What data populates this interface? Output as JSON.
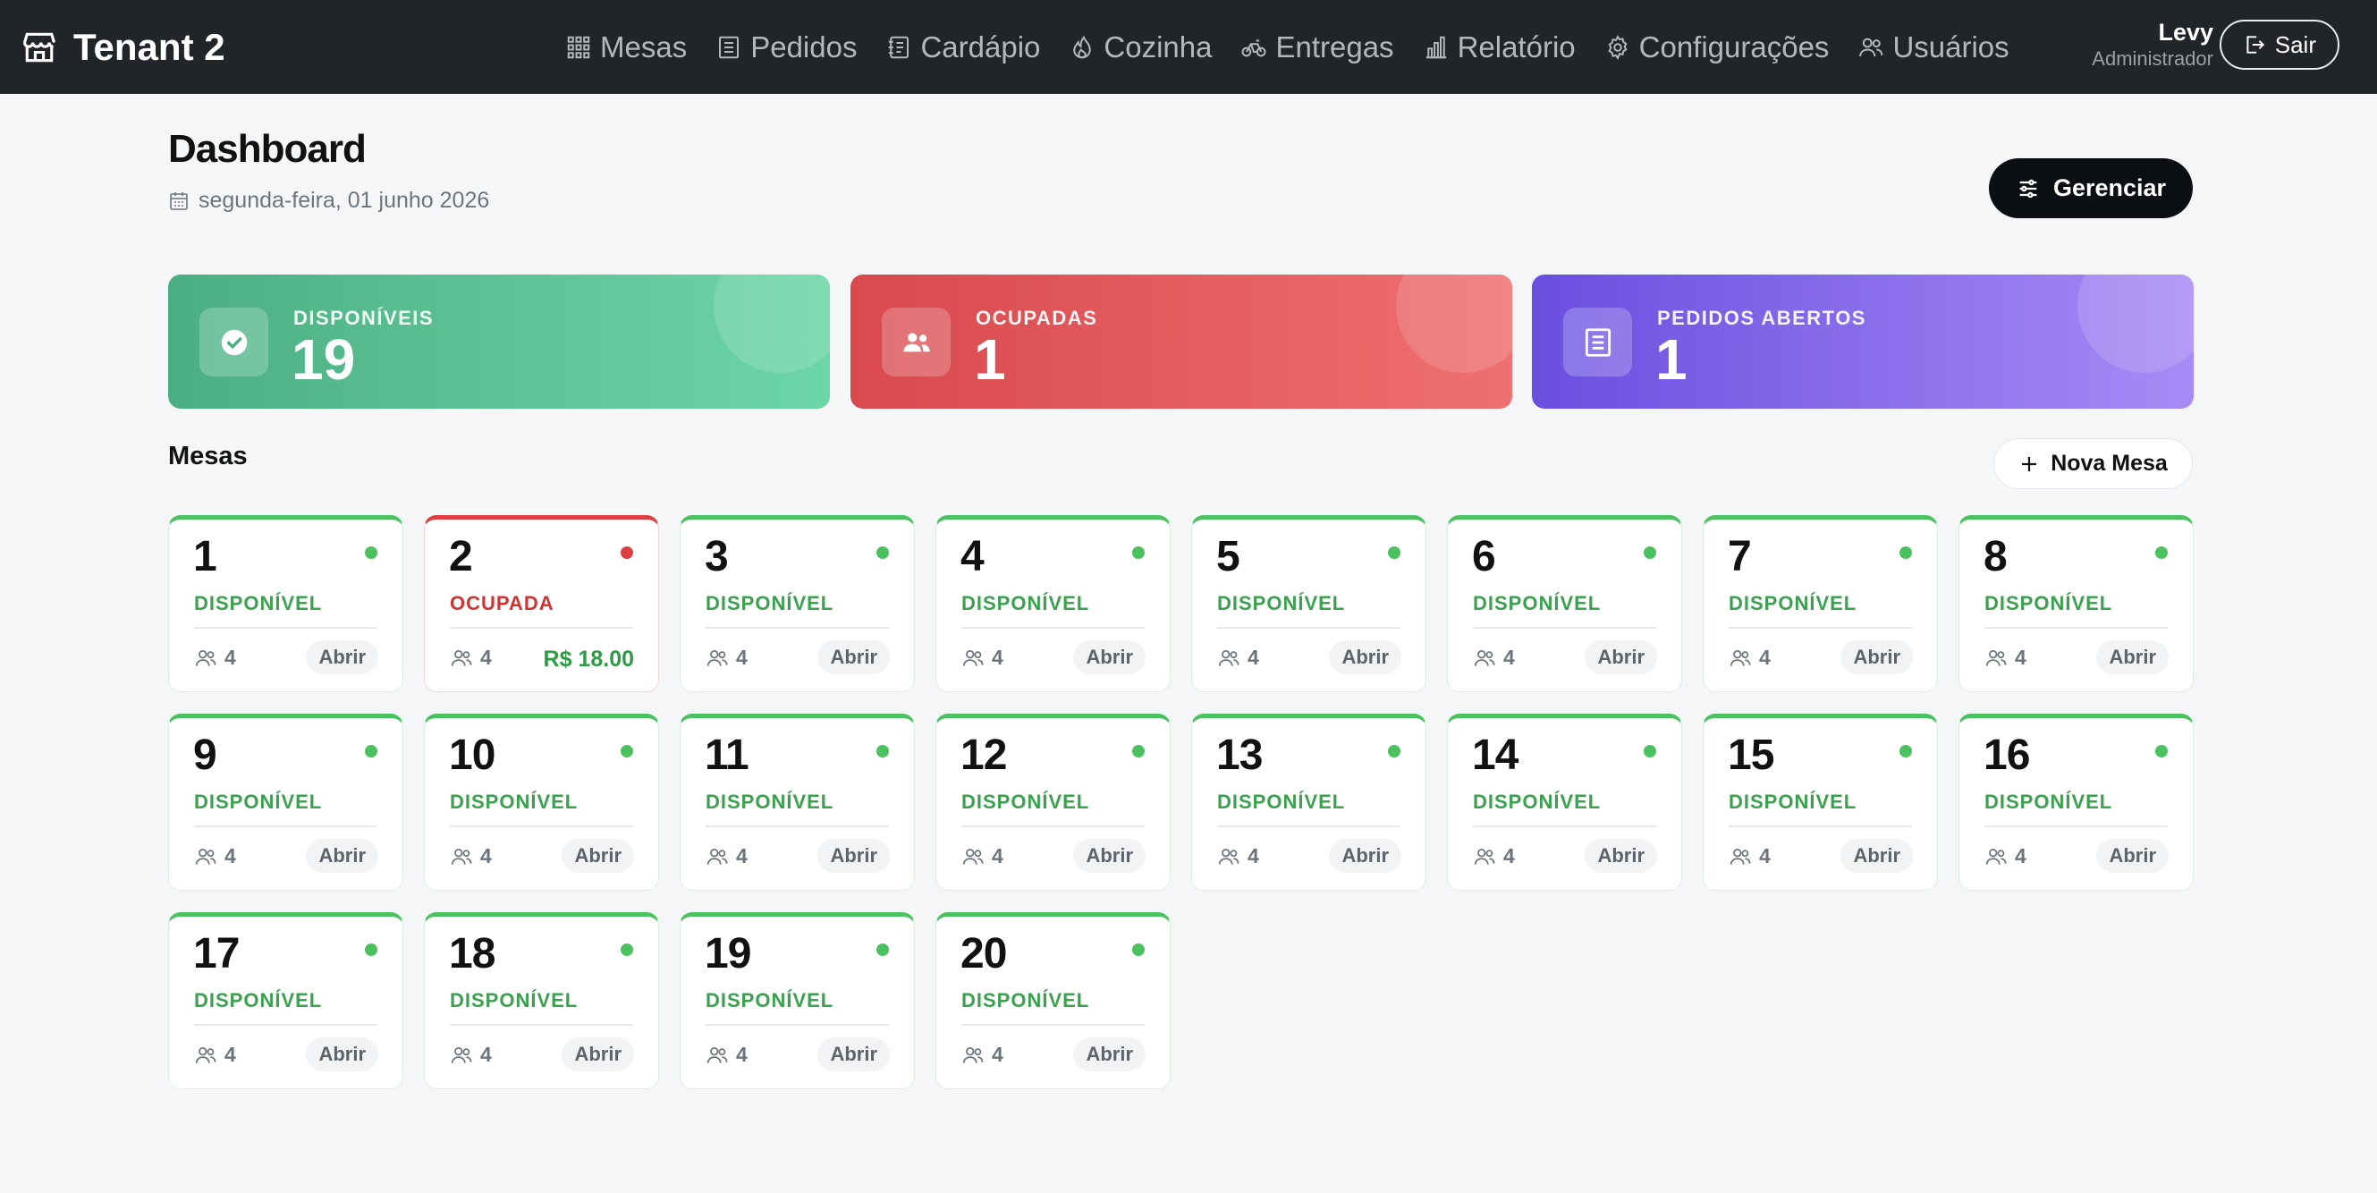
{
  "brand": {
    "name": "Tenant 2",
    "icon": "store-icon"
  },
  "nav": [
    {
      "label": "Mesas",
      "icon": "grid-icon",
      "name": "nav-item-mesas"
    },
    {
      "label": "Pedidos",
      "icon": "receipt-icon",
      "name": "nav-item-pedidos"
    },
    {
      "label": "Cardápio",
      "icon": "menu-book-icon",
      "name": "nav-item-cardapio"
    },
    {
      "label": "Cozinha",
      "icon": "fire-icon",
      "name": "nav-item-cozinha"
    },
    {
      "label": "Entregas",
      "icon": "bicycle-icon",
      "name": "nav-item-entregas"
    },
    {
      "label": "Relatório",
      "icon": "bar-chart-icon",
      "name": "nav-item-relatorio"
    },
    {
      "label": "Configurações",
      "icon": "gear-icon",
      "name": "nav-item-configuracoes"
    },
    {
      "label": "Usuários",
      "icon": "users-icon",
      "name": "nav-item-usuarios"
    }
  ],
  "user": {
    "name": "Levy",
    "role": "Administrador"
  },
  "logout_label": "Sair",
  "header": {
    "title": "Dashboard",
    "date": "segunda-feira, 01 junho 2026",
    "manage_label": "Gerenciar"
  },
  "stats": {
    "available": {
      "label": "DISPONÍVEIS",
      "value": "19",
      "color": "#4caf83"
    },
    "occupied": {
      "label": "OCUPADAS",
      "value": "1",
      "color": "#d9494e"
    },
    "open_orders": {
      "label": "PEDIDOS ABERTOS",
      "value": "1",
      "color": "#6a4fe0"
    }
  },
  "tables_section": {
    "title": "Mesas",
    "new_label": "Nova Mesa"
  },
  "tables": [
    {
      "number": "1",
      "status": "DISPONÍVEL",
      "seats": "4",
      "action": "Abrir"
    },
    {
      "number": "2",
      "status": "OCUPADA",
      "seats": "4",
      "amount": "R$ 18.00"
    },
    {
      "number": "3",
      "status": "DISPONÍVEL",
      "seats": "4",
      "action": "Abrir"
    },
    {
      "number": "4",
      "status": "DISPONÍVEL",
      "seats": "4",
      "action": "Abrir"
    },
    {
      "number": "5",
      "status": "DISPONÍVEL",
      "seats": "4",
      "action": "Abrir"
    },
    {
      "number": "6",
      "status": "DISPONÍVEL",
      "seats": "4",
      "action": "Abrir"
    },
    {
      "number": "7",
      "status": "DISPONÍVEL",
      "seats": "4",
      "action": "Abrir"
    },
    {
      "number": "8",
      "status": "DISPONÍVEL",
      "seats": "4",
      "action": "Abrir"
    },
    {
      "number": "9",
      "status": "DISPONÍVEL",
      "seats": "4",
      "action": "Abrir"
    },
    {
      "number": "10",
      "status": "DISPONÍVEL",
      "seats": "4",
      "action": "Abrir"
    },
    {
      "number": "11",
      "status": "DISPONÍVEL",
      "seats": "4",
      "action": "Abrir"
    },
    {
      "number": "12",
      "status": "DISPONÍVEL",
      "seats": "4",
      "action": "Abrir"
    },
    {
      "number": "13",
      "status": "DISPONÍVEL",
      "seats": "4",
      "action": "Abrir"
    },
    {
      "number": "14",
      "status": "DISPONÍVEL",
      "seats": "4",
      "action": "Abrir"
    },
    {
      "number": "15",
      "status": "DISPONÍVEL",
      "seats": "4",
      "action": "Abrir"
    },
    {
      "number": "16",
      "status": "DISPONÍVEL",
      "seats": "4",
      "action": "Abrir"
    },
    {
      "number": "17",
      "status": "DISPONÍVEL",
      "seats": "4",
      "action": "Abrir"
    },
    {
      "number": "18",
      "status": "DISPONÍVEL",
      "seats": "4",
      "action": "Abrir"
    },
    {
      "number": "19",
      "status": "DISPONÍVEL",
      "seats": "4",
      "action": "Abrir"
    },
    {
      "number": "20",
      "status": "DISPONÍVEL",
      "seats": "4",
      "action": "Abrir"
    }
  ]
}
